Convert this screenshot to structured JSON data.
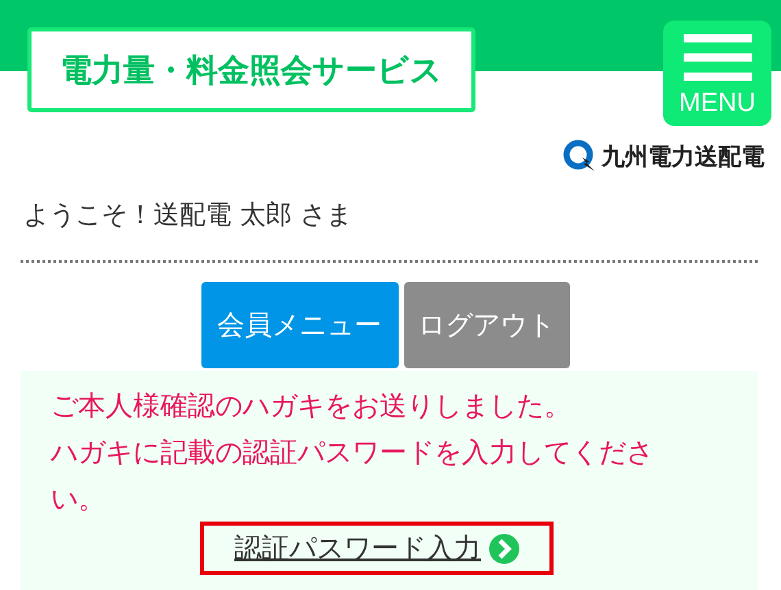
{
  "header": {
    "title": "電力量・料金照会サービス",
    "menu_label": "MENU",
    "logo_text": "九州電力送配電"
  },
  "welcome": "ようこそ！送配電 太郎 さま",
  "buttons": [
    {
      "label": "会員メニュー",
      "kind": "primary"
    },
    {
      "label": "ログアウト",
      "kind": "secondary"
    }
  ],
  "notice": {
    "messages": [
      "ご本人様確認のハガキをお送りしました。",
      "ハガキに記載の認証パスワードを入力してください。"
    ],
    "link": "認証パスワード入力"
  }
}
